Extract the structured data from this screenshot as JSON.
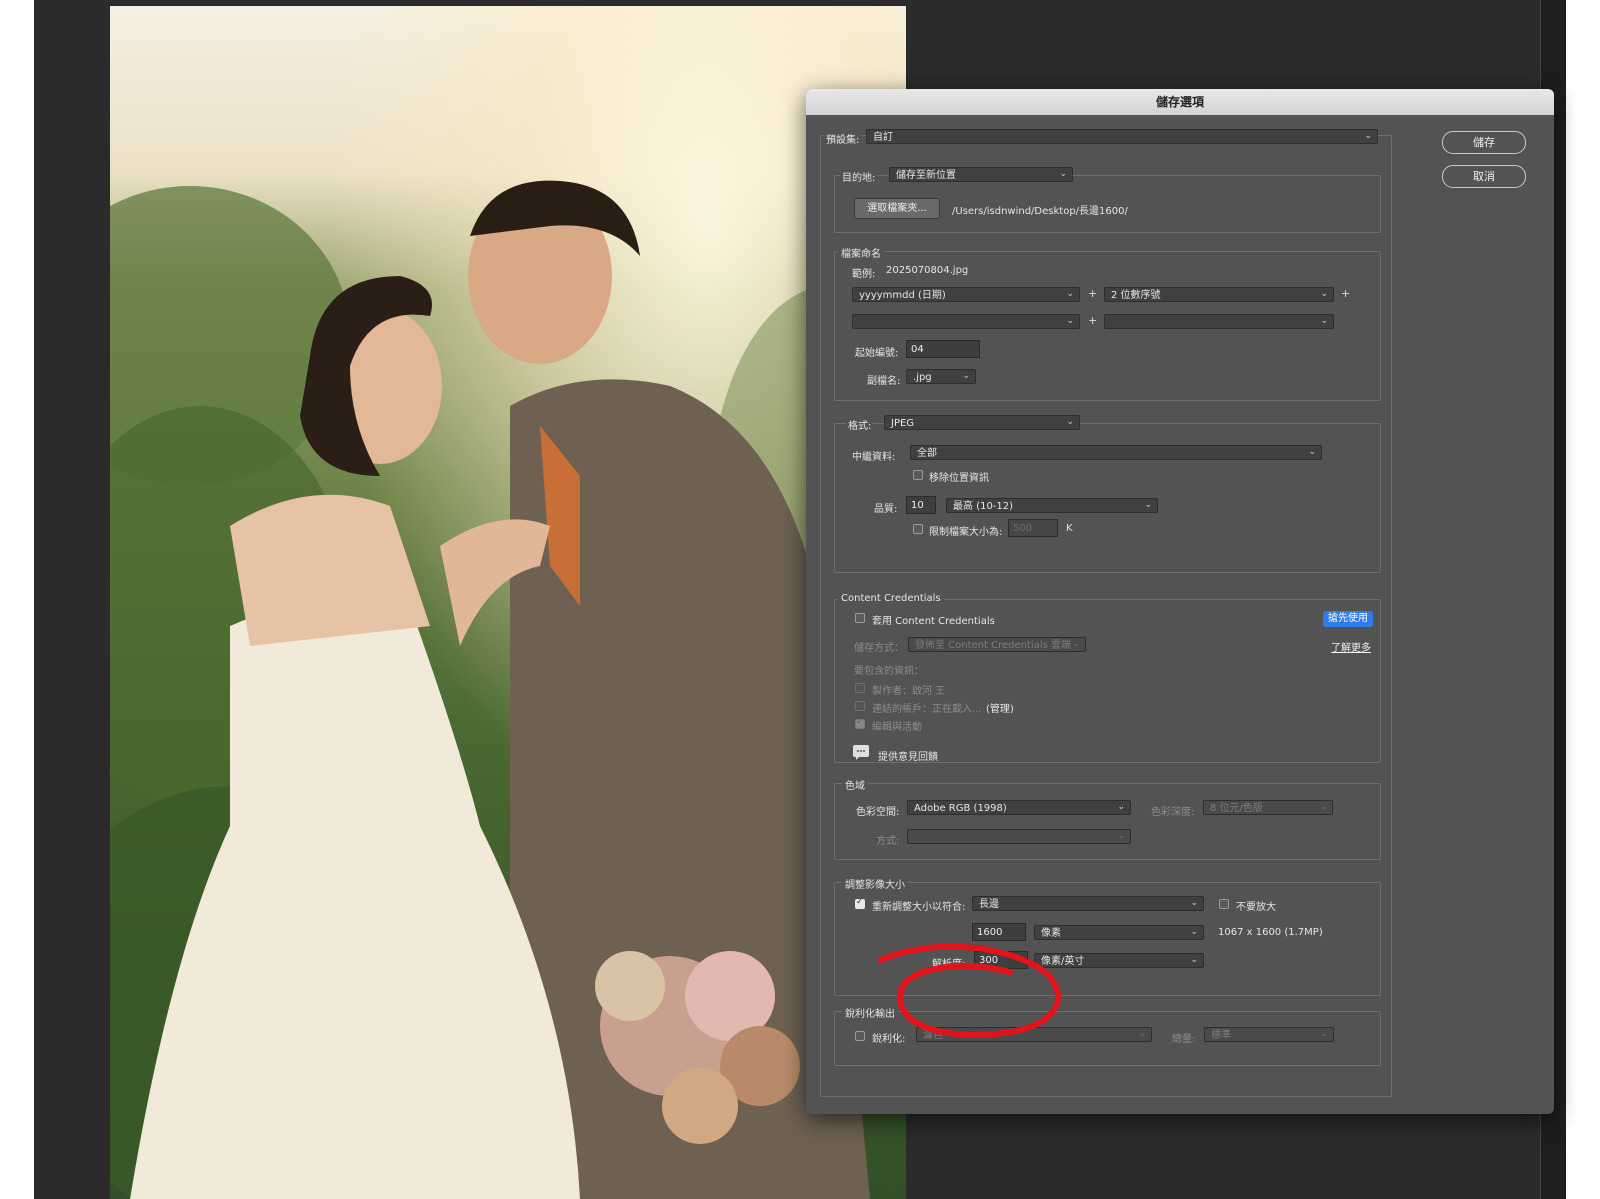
{
  "dialog": {
    "title": "儲存選項",
    "save_button": "儲存",
    "cancel_button": "取消",
    "preset": {
      "label": "預設集:",
      "value": "自訂"
    },
    "destination": {
      "label": "目的地:",
      "value": "儲存至新位置",
      "choose_button": "選取檔案夾...",
      "path": "/Users/isdnwind/Desktop/長邊1600/"
    },
    "naming": {
      "title": "檔案命名",
      "example_label": "範例:",
      "example_value": "2025070804.jpg",
      "field1": "yyyymmdd (日期)",
      "field2": "2 位數序號",
      "field3": "",
      "field4": "",
      "plus": "+",
      "start_label": "起始編號:",
      "start_value": "04",
      "ext_label": "副檔名:",
      "ext_value": ".jpg"
    },
    "format": {
      "label": "格式:",
      "value": "JPEG",
      "metadata_label": "中繼資料:",
      "metadata_value": "全部",
      "remove_location": "移除位置資訊",
      "quality_label": "品質:",
      "quality_value": "10",
      "quality_preset": "最高 (10-12)",
      "limit_label": "限制檔案大小為:",
      "limit_value": "500",
      "limit_unit": "K"
    },
    "credentials": {
      "title": "Content Credentials",
      "apply": "套用 Content Credentials",
      "early_access": "搶先使用",
      "learn_more": "了解更多",
      "storage_label": "儲存方式：",
      "storage_value": "發佈至 Content Credentials 雲端",
      "include_label": "要包含的資訊：",
      "producer": "製作者：啟河 王",
      "connected": "連結的帳戶：正在載入...",
      "manage": "(管理)",
      "edits": "編輯與活動",
      "feedback": "提供意見回饋"
    },
    "color": {
      "title": "色域",
      "space_label": "色彩空間:",
      "space_value": "Adobe RGB (1998)",
      "depth_label": "色彩深度:",
      "depth_value": "8 位元/色版",
      "method_label": "方式:",
      "method_value": ""
    },
    "resize": {
      "title": "調整影像大小",
      "fit_label": "重新調整大小以符合:",
      "fit_value": "長邊",
      "no_enlarge": "不要放大",
      "size_value": "1600",
      "unit_value": "像素",
      "dims": "1067 x 1600 (1.7MP)",
      "res_label": "解析度:",
      "res_value": "300",
      "res_unit": "像素/英寸"
    },
    "sharpen": {
      "title": "銳利化輸出",
      "label": "銳利化:",
      "value": "濾色",
      "amount_label": "總量:",
      "amount_value": "標準"
    }
  },
  "colors": {
    "dialog_bg": "#535353",
    "annotation": "#e3121b",
    "accent": "#2e7de6"
  }
}
